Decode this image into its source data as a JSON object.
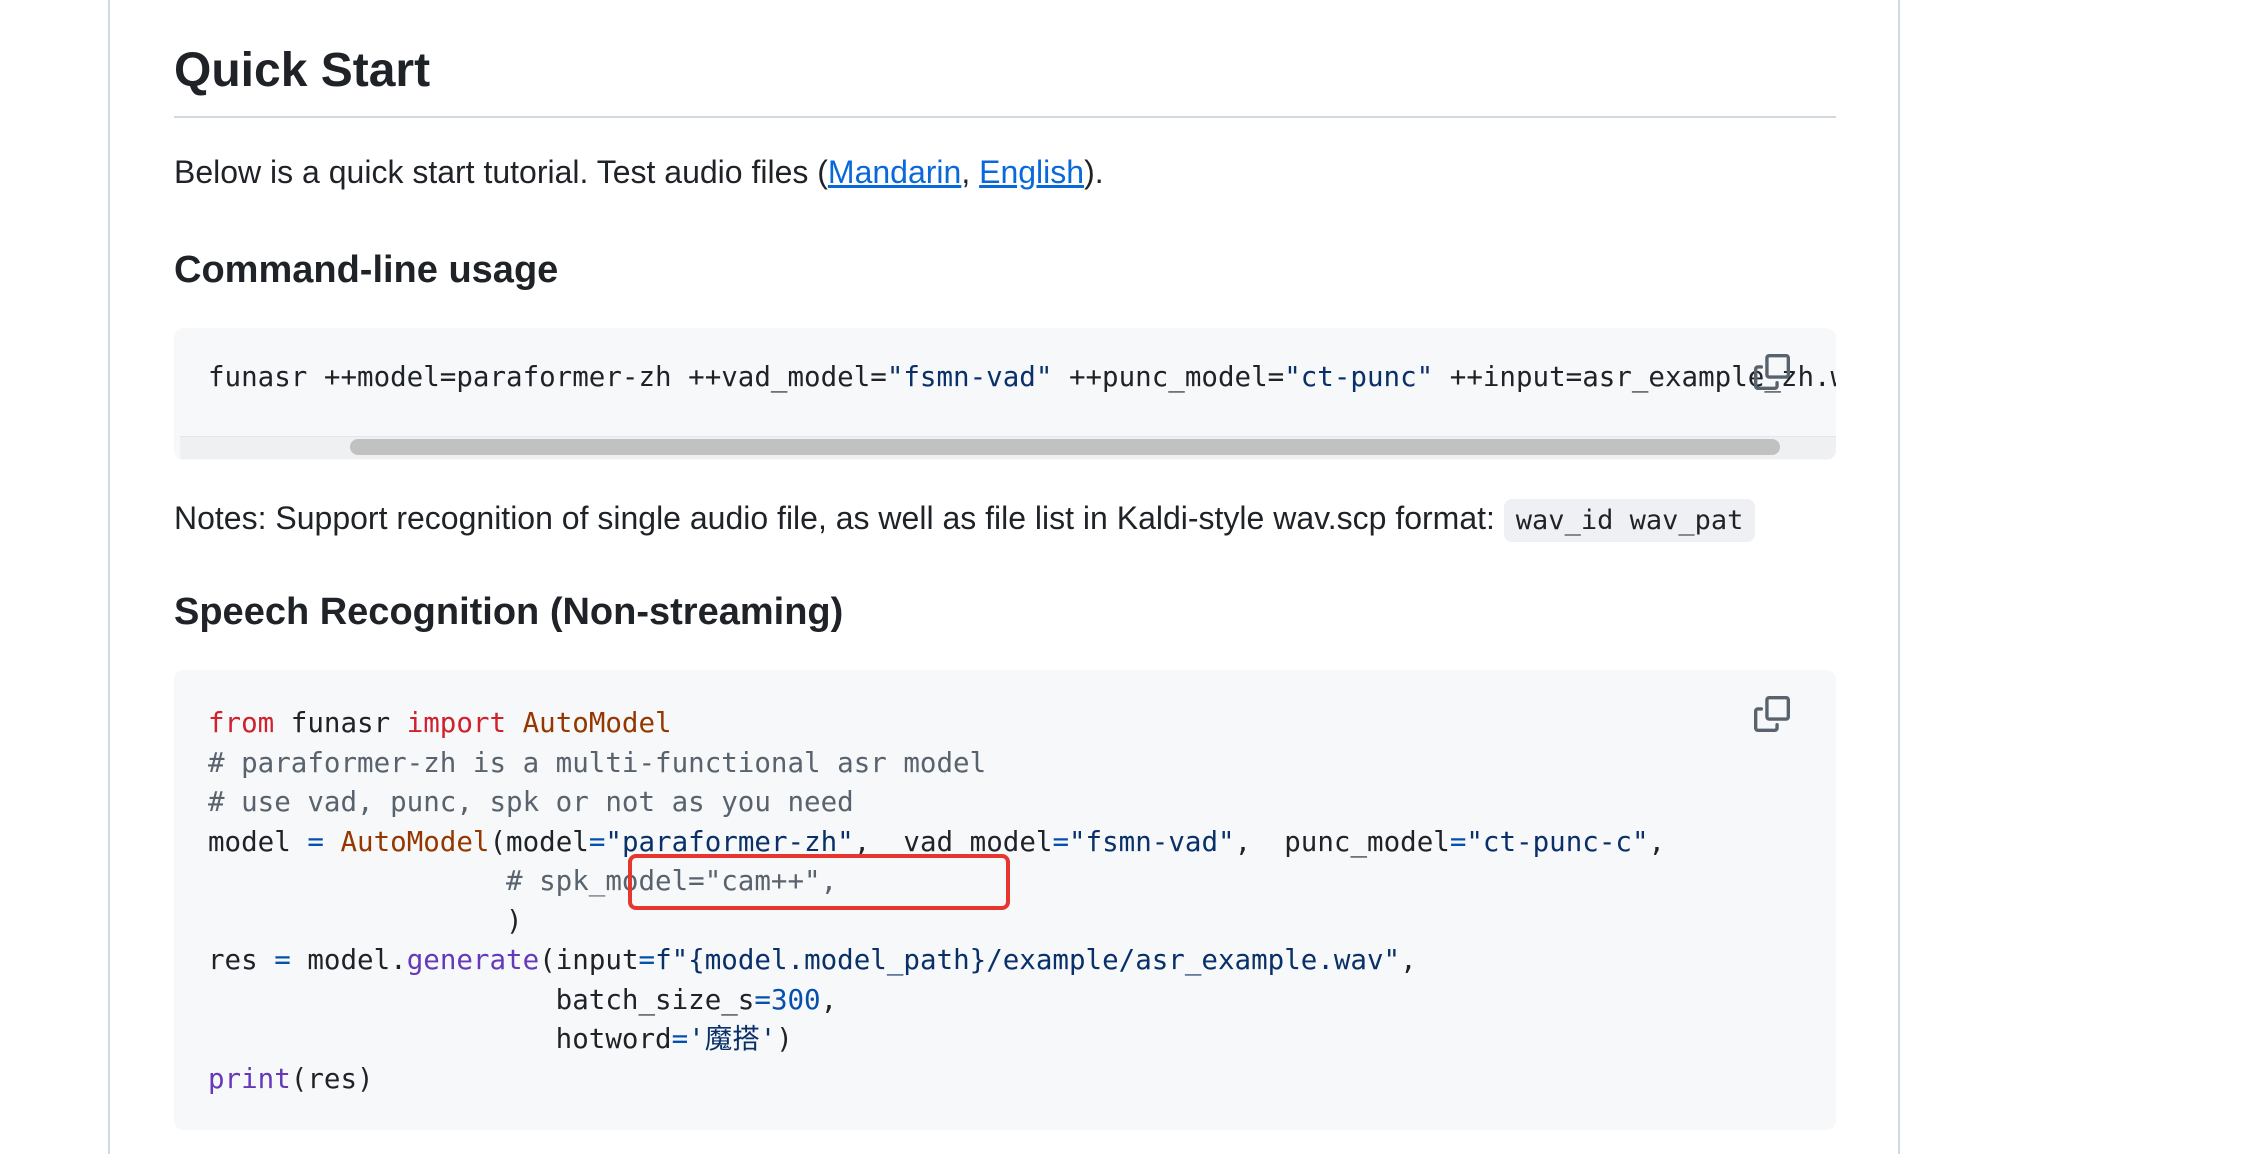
{
  "section_title": "Quick Start",
  "intro": {
    "prefix": "Below is a quick start tutorial. Test audio files (",
    "link1": "Mandarin",
    "sep": ", ",
    "link2": "English",
    "suffix": ")."
  },
  "cmd_heading": "Command-line usage",
  "cmd": {
    "part1": "funasr ++model=paraformer-zh ++vad_model=",
    "str1": "\"fsmn-vad\"",
    "part2": " ++punc_model=",
    "str2": "\"ct-punc\"",
    "part3": " ++input=asr_example_zh.wav"
  },
  "notes": {
    "text": "Notes: Support recognition of single audio file, as well as file list in Kaldi-style wav.scp format: ",
    "code": "wav_id wav_pat"
  },
  "sr_heading": "Speech Recognition (Non-streaming)",
  "code": {
    "l1_kw1": "from",
    "l1_mod": " funasr ",
    "l1_kw2": "import",
    "l1_cls": " AutoModel",
    "l2": "# paraformer-zh is a multi-functional asr model",
    "l3": "# use vad, punc, spk or not as you need",
    "l4_a": "model ",
    "l4_eq": "=",
    "l4_cls": " AutoModel",
    "l4_b": "(model",
    "l4_eq2": "=",
    "l4_s1": "\"paraformer-zh\"",
    "l4_c": ",  vad_model",
    "l4_eq3": "=",
    "l4_s2": "\"fsmn-vad\"",
    "l4_d": ",  punc_model",
    "l4_eq4": "=",
    "l4_s3": "\"ct-punc-c\"",
    "l4_e": ",",
    "l5_indent": "                  ",
    "l5": "# spk_model=\"cam++\",",
    "l6": "                  )",
    "l7_a": "res ",
    "l7_eq": "=",
    "l7_b": " model.",
    "l7_fn": "generate",
    "l7_c": "(input",
    "l7_eq2": "=",
    "l7_s": "f\"{model.model_path}/example/asr_example.wav\"",
    "l7_d": ",",
    "l8_a": "                     batch_size_s",
    "l8_eq": "=",
    "l8_n": "300",
    "l8_b": ",",
    "l9_a": "                     hotword",
    "l9_eq": "=",
    "l9_s": "'魔搭'",
    "l9_b": ")",
    "l10_fn": "print",
    "l10_b": "(res)"
  },
  "colors": {
    "link": "#0969da",
    "keyword": "#cf222e",
    "class": "#953800",
    "comment": "#59636e",
    "string": "#0a3069",
    "operator": "#0550ae",
    "call": "#6639ba",
    "highlight_box": "#e5372f"
  },
  "icons": {
    "copy": "copy-icon"
  }
}
